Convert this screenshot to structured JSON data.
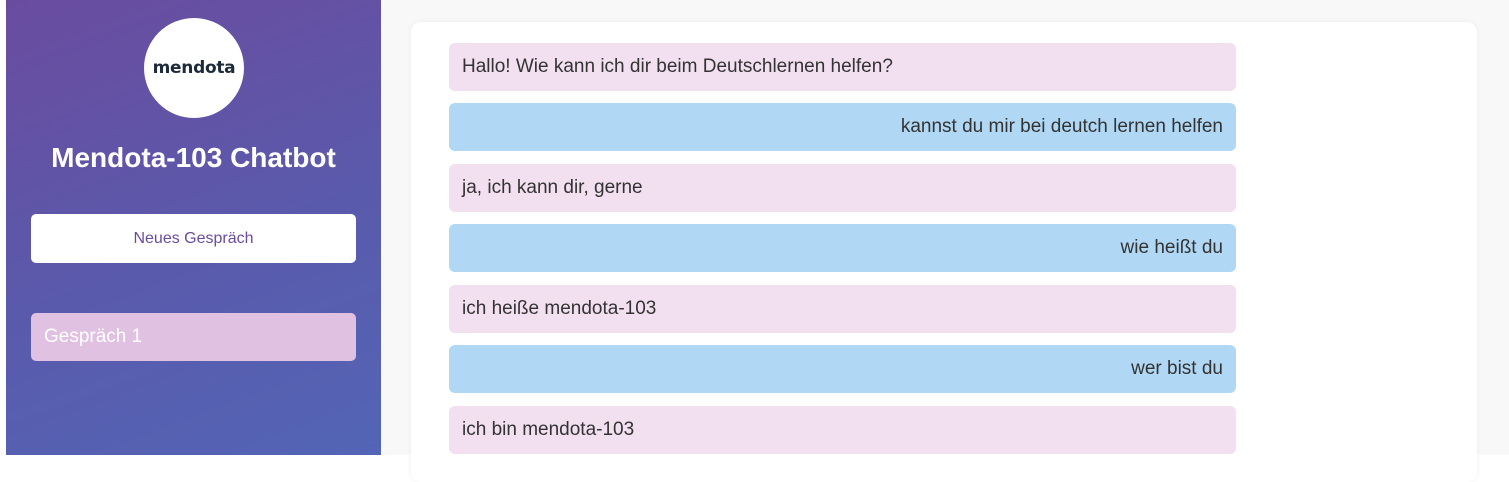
{
  "sidebar": {
    "logo_text": "mendota",
    "title": "Mendota-103 Chatbot",
    "new_chat_label": "Neues Gespräch",
    "conversations": [
      {
        "label": "Gespräch 1"
      }
    ]
  },
  "chat": {
    "messages": [
      {
        "role": "bot",
        "text": "Hallo! Wie kann ich dir beim Deutschlernen helfen?"
      },
      {
        "role": "user",
        "text": "kannst du mir bei deutch lernen helfen"
      },
      {
        "role": "bot",
        "text": "ja, ich kann dir, gerne"
      },
      {
        "role": "user",
        "text": "wie heißt du"
      },
      {
        "role": "bot",
        "text": "ich heiße mendota-103"
      },
      {
        "role": "user",
        "text": "wer bist du"
      },
      {
        "role": "bot",
        "text": "ich bin mendota-103"
      }
    ]
  },
  "colors": {
    "sidebar_gradient_start": "#6a4c9f",
    "sidebar_gradient_end": "#5365b6",
    "bot_bubble": "#f2e0f0",
    "user_bubble": "#b0d8f5",
    "active_conversation": "#e0c1e2"
  }
}
